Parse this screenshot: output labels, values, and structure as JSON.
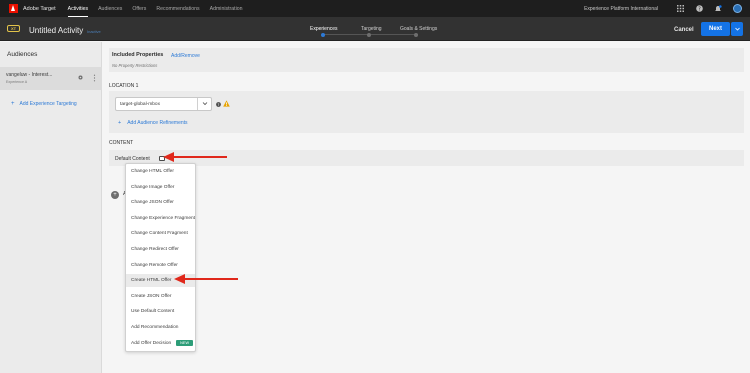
{
  "topnav": {
    "brand": "Adobe Target",
    "items": [
      {
        "label": "Activities",
        "active": true
      },
      {
        "label": "Audiences",
        "active": false
      },
      {
        "label": "Offers",
        "active": false
      },
      {
        "label": "Recommendations",
        "active": false
      },
      {
        "label": "Administration",
        "active": false
      }
    ],
    "org": "Experience Platform International",
    "icons": [
      "apps-grid-icon",
      "help-icon",
      "notifications-bell-icon",
      "user-avatar"
    ]
  },
  "activity": {
    "type_badge": "XT",
    "title": "Untitled Activity",
    "status": "Inactive",
    "steps": [
      {
        "label": "Experiences",
        "active": true
      },
      {
        "label": "Targeting",
        "active": false
      },
      {
        "label": "Goals & Settings",
        "active": false
      }
    ],
    "cancel_label": "Cancel",
    "next_label": "Next"
  },
  "sidebar": {
    "title": "Audiences",
    "audience": {
      "name": "vangeluw - Interest...",
      "sub": "Experience A"
    },
    "add_targeting": "Add Experience Targeting"
  },
  "main": {
    "properties_title": "Included Properties",
    "properties_link": "Add/Remove",
    "properties_sub": "No Property Restrictions",
    "location_label": "LOCATION 1",
    "mbox_value": "target-global-mbox",
    "add_refinements": "Add Audience Refinements",
    "content_label": "CONTENT",
    "default_content": "Default Content",
    "add_partial": "A"
  },
  "menu": {
    "items": [
      {
        "label": "Change HTML Offer"
      },
      {
        "label": "Change Image Offer"
      },
      {
        "label": "Change JSON Offer"
      },
      {
        "label": "Change Experience Fragment"
      },
      {
        "label": "Change Content Fragment"
      },
      {
        "label": "Change Redirect Offer"
      },
      {
        "label": "Change Remote Offer"
      },
      {
        "label": "Create HTML Offer",
        "highlighted": true
      },
      {
        "label": "Create JSON Offer"
      },
      {
        "label": "Use Default Content"
      },
      {
        "label": "Add Recommendation"
      },
      {
        "label": "Add Offer Decision",
        "badge": "NEW"
      }
    ]
  },
  "colors": {
    "accent_blue": "#1473e6",
    "link_blue": "#2d7ad6",
    "arrow_red": "#e0281b",
    "badge_yellow": "#e2c34a",
    "new_badge_green": "#2d9d78"
  }
}
